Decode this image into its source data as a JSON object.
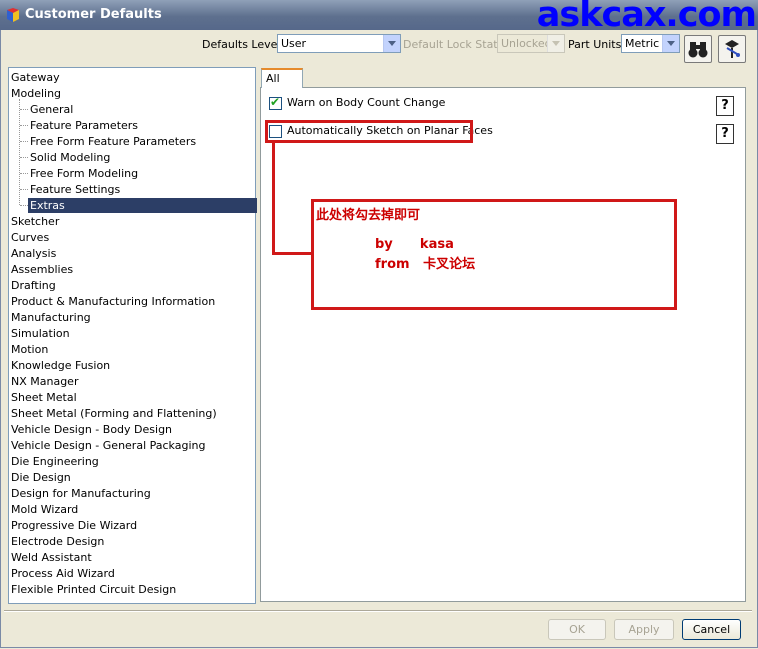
{
  "window": {
    "title": "Customer Defaults",
    "watermark": "askcax.com"
  },
  "toolbar": {
    "defaults_level_label": "Defaults Level",
    "defaults_level_value": "User",
    "lock_state_label": "Default Lock State",
    "lock_state_value": "Unlocked",
    "part_units_label": "Part Units",
    "part_units_value": "Metric",
    "find_icon": "binoculars-icon",
    "report_icon": "report-icon"
  },
  "tree": {
    "items": [
      {
        "label": "Gateway",
        "level": 0
      },
      {
        "label": "Modeling",
        "level": 0
      },
      {
        "label": "General",
        "level": 1
      },
      {
        "label": "Feature Parameters",
        "level": 1
      },
      {
        "label": "Free Form Feature Parameters",
        "level": 1
      },
      {
        "label": "Solid Modeling",
        "level": 1
      },
      {
        "label": "Free Form Modeling",
        "level": 1
      },
      {
        "label": "Feature Settings",
        "level": 1
      },
      {
        "label": "Extras",
        "level": 1,
        "selected": true
      },
      {
        "label": "Sketcher",
        "level": 0
      },
      {
        "label": "Curves",
        "level": 0
      },
      {
        "label": "Analysis",
        "level": 0
      },
      {
        "label": "Assemblies",
        "level": 0
      },
      {
        "label": "Drafting",
        "level": 0
      },
      {
        "label": "Product & Manufacturing Information",
        "level": 0
      },
      {
        "label": "Manufacturing",
        "level": 0
      },
      {
        "label": "Simulation",
        "level": 0
      },
      {
        "label": "Motion",
        "level": 0
      },
      {
        "label": "Knowledge Fusion",
        "level": 0
      },
      {
        "label": "NX Manager",
        "level": 0
      },
      {
        "label": "Sheet Metal",
        "level": 0
      },
      {
        "label": "Sheet Metal (Forming and Flattening)",
        "level": 0
      },
      {
        "label": "Vehicle Design - Body Design",
        "level": 0
      },
      {
        "label": "Vehicle Design - General Packaging",
        "level": 0
      },
      {
        "label": "Die Engineering",
        "level": 0
      },
      {
        "label": "Die Design",
        "level": 0
      },
      {
        "label": "Design for Manufacturing",
        "level": 0
      },
      {
        "label": "Mold Wizard",
        "level": 0
      },
      {
        "label": "Progressive Die Wizard",
        "level": 0
      },
      {
        "label": "Electrode Design",
        "level": 0
      },
      {
        "label": "Weld Assistant",
        "level": 0
      },
      {
        "label": "Process Aid Wizard",
        "level": 0
      },
      {
        "label": "Flexible Printed Circuit Design",
        "level": 0
      }
    ]
  },
  "tabs": [
    {
      "label": "All"
    }
  ],
  "options": [
    {
      "label": "Warn on Body Count Change",
      "checked": true
    },
    {
      "label": "Automatically Sketch on Planar Faces",
      "checked": false
    }
  ],
  "annotation": {
    "line1": "此处将勾去掉即可",
    "line2": "by      kasa",
    "line3": "from   卡叉论坛"
  },
  "buttons": {
    "ok": "OK",
    "apply": "Apply",
    "cancel": "Cancel"
  }
}
